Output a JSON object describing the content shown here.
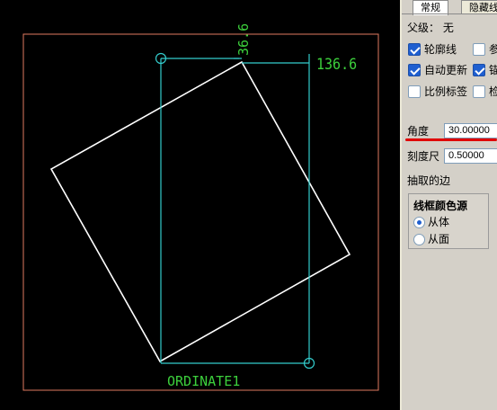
{
  "canvas": {
    "dimension_vertical": "36.6",
    "dimension_horizontal": "136.6",
    "ordinate_label": "ORDINATE1",
    "colors": {
      "border": "#e07a5f",
      "shape": "#ffffff",
      "dimension": "#33cccc",
      "text": "#3ccf3c"
    }
  },
  "panel": {
    "tabs": [
      "常规",
      "隐藏线"
    ],
    "parent_label": "父级：",
    "parent_value": "无",
    "checkboxes": [
      {
        "label": "轮廓线",
        "checked": true
      },
      {
        "label": "参",
        "checked": false
      },
      {
        "label": "自动更新",
        "checked": true
      },
      {
        "label": "锚",
        "checked": true
      },
      {
        "label": "比例标签",
        "checked": false
      },
      {
        "label": "检",
        "checked": false
      }
    ],
    "angle_label": "角度",
    "angle_value": "30.00000",
    "scale_label": "刻度尺",
    "scale_value": "0.50000",
    "extract_edges_label": "抽取的边",
    "color_source_title": "线框颜色源",
    "color_source_options": [
      {
        "label": "从体",
        "selected": true
      },
      {
        "label": "从面",
        "selected": false
      }
    ]
  }
}
